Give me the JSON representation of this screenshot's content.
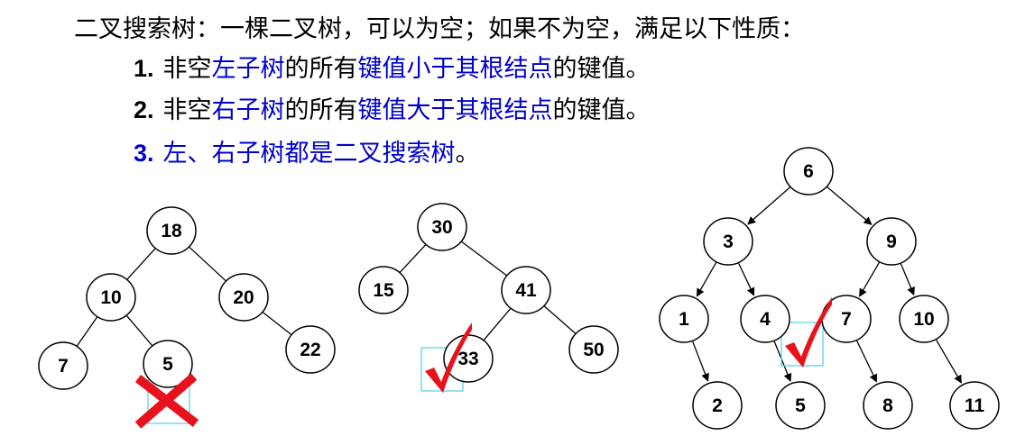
{
  "heading": "二叉搜索树：一棵二叉树，可以为空；如果不为空，满足以下性质：",
  "rules": [
    {
      "num": "1.",
      "parts": [
        {
          "text": "非空",
          "blue": false
        },
        {
          "text": "左子树",
          "blue": true
        },
        {
          "text": "的所有",
          "blue": false
        },
        {
          "text": "键值小于其根结点",
          "blue": true
        },
        {
          "text": "的键值。",
          "blue": false
        }
      ]
    },
    {
      "num": "2.",
      "parts": [
        {
          "text": "非空",
          "blue": false
        },
        {
          "text": "右子树",
          "blue": true
        },
        {
          "text": "的所有",
          "blue": false
        },
        {
          "text": "键值大于其根结点",
          "blue": true
        },
        {
          "text": "的键值。",
          "blue": false
        }
      ]
    },
    {
      "num": "3.",
      "num_blue": true,
      "parts": [
        {
          "text": "左、右子树都是二叉搜索树",
          "blue": true
        },
        {
          "text": "。",
          "blue": false
        }
      ]
    }
  ],
  "trees": [
    {
      "id": "tree-1",
      "verdict": "cross",
      "nodes": [
        "18",
        "10",
        "20",
        "7",
        "5",
        "22"
      ],
      "edges": [
        [
          "18",
          "10"
        ],
        [
          "18",
          "20"
        ],
        [
          "10",
          "7"
        ],
        [
          "10",
          "5"
        ],
        [
          "20",
          "22"
        ]
      ],
      "directed": false,
      "flagged_node": "5"
    },
    {
      "id": "tree-2",
      "verdict": "check",
      "nodes": [
        "30",
        "15",
        "41",
        "33",
        "50"
      ],
      "edges": [
        [
          "30",
          "15"
        ],
        [
          "30",
          "41"
        ],
        [
          "41",
          "33"
        ],
        [
          "41",
          "50"
        ]
      ],
      "directed": false,
      "flagged_node": "33"
    },
    {
      "id": "tree-3",
      "verdict": "check",
      "nodes": [
        "6",
        "3",
        "9",
        "1",
        "4",
        "7",
        "10",
        "2",
        "5",
        "8",
        "11"
      ],
      "edges": [
        [
          "6",
          "3"
        ],
        [
          "6",
          "9"
        ],
        [
          "3",
          "1"
        ],
        [
          "3",
          "4"
        ],
        [
          "9",
          "7"
        ],
        [
          "9",
          "10"
        ],
        [
          "1",
          "2"
        ],
        [
          "4",
          "5"
        ],
        [
          "7",
          "8"
        ],
        [
          "10",
          "11"
        ]
      ],
      "directed": true,
      "flagged_node": "5"
    }
  ],
  "colors": {
    "text": "#000000",
    "emphasis": "#0000cc",
    "mark": "#e8121c",
    "highlight_box": "#5fd3e8"
  }
}
